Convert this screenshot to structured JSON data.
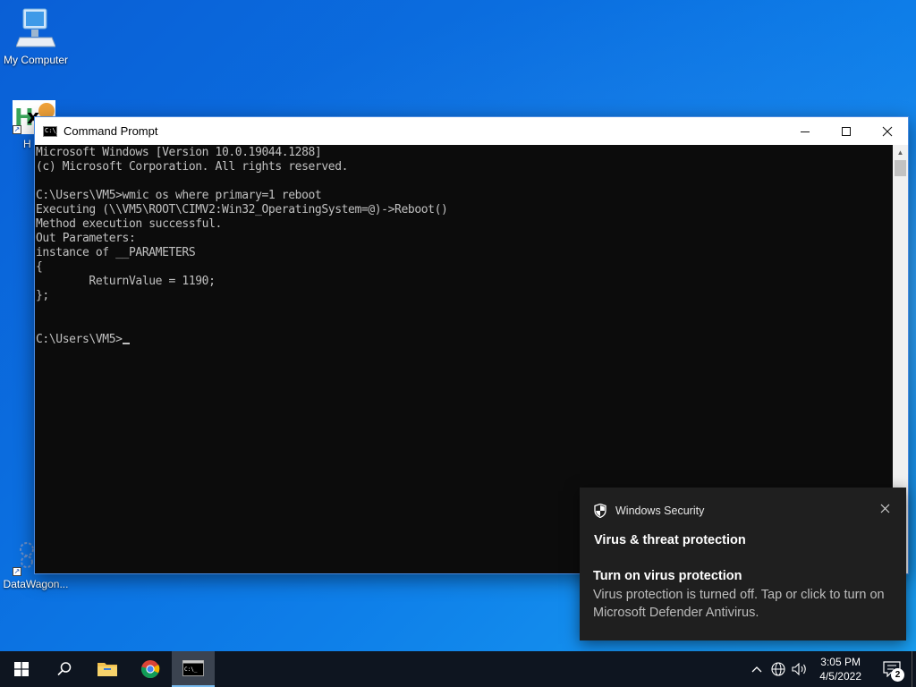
{
  "desktop": {
    "icons": [
      {
        "label": "My Computer"
      },
      {
        "label": "H"
      },
      {
        "label": "DataWagon..."
      }
    ]
  },
  "cmd": {
    "title": "Command Prompt",
    "lines": [
      "Microsoft Windows [Version 10.0.19044.1288]",
      "(c) Microsoft Corporation. All rights reserved.",
      "",
      "C:\\Users\\VM5>wmic os where primary=1 reboot",
      "Executing (\\\\VM5\\ROOT\\CIMV2:Win32_OperatingSystem=@)->Reboot()",
      "Method execution successful.",
      "Out Parameters:",
      "instance of __PARAMETERS",
      "{",
      "        ReturnValue = 1190;",
      "};",
      "",
      ""
    ],
    "prompt": "C:\\Users\\VM5>",
    "text_color": "#c0c0c0",
    "background": "#0c0c0c"
  },
  "toast": {
    "app_name": "Windows Security",
    "title": "Virus & threat protection",
    "subtitle": "Turn on virus protection",
    "body": "Virus protection is turned off. Tap or click to turn on Microsoft Defender Antivirus."
  },
  "taskbar": {
    "time": "3:05 PM",
    "date": "4/5/2022",
    "notification_count": "2"
  }
}
